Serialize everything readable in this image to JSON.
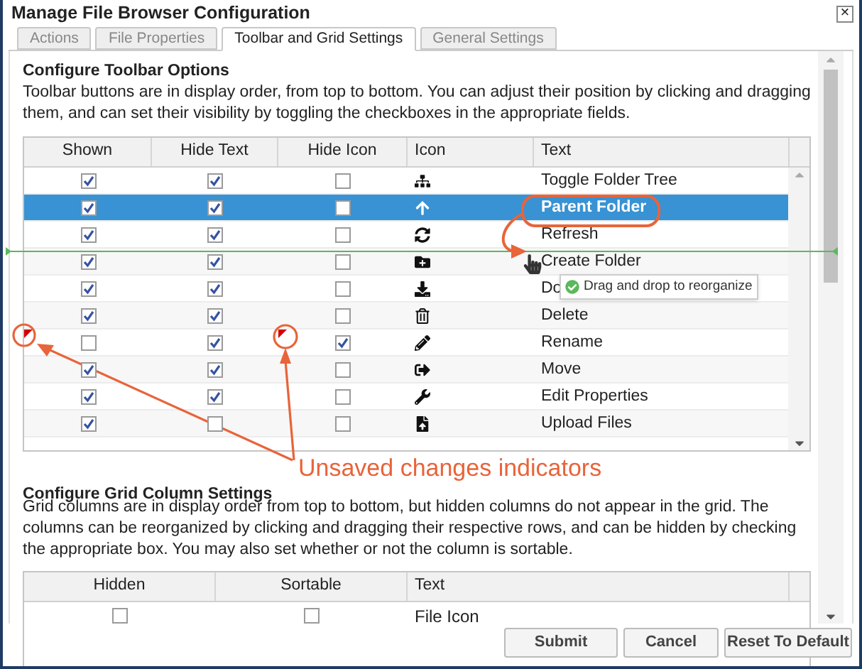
{
  "window": {
    "title": "Manage File Browser Configuration",
    "close": "×"
  },
  "tabs": [
    {
      "label": "Actions",
      "selected": false
    },
    {
      "label": "File Properties",
      "selected": false
    },
    {
      "label": "Toolbar and Grid Settings",
      "selected": true
    },
    {
      "label": "General Settings",
      "selected": false
    }
  ],
  "toolbar_section": {
    "heading": "Configure Toolbar Options",
    "description": "Toolbar buttons are in display order, from top to bottom. You can adjust their position by clicking and dragging them, and can set their visibility by toggling the checkboxes in the appropriate fields.",
    "columns": [
      "Shown",
      "Hide Text",
      "Hide Icon",
      "Icon",
      "Text"
    ],
    "rows": [
      {
        "kind": "tree",
        "text": "Toggle Folder Tree",
        "shown": true,
        "hide_text": true,
        "hide_icon": false,
        "shown_changed": false,
        "hide_icon_changed": false,
        "selected": false
      },
      {
        "kind": "up",
        "text": "Parent Folder",
        "shown": true,
        "hide_text": true,
        "hide_icon": false,
        "shown_changed": false,
        "hide_icon_changed": false,
        "selected": true
      },
      {
        "kind": "refresh",
        "text": "Refresh",
        "shown": true,
        "hide_text": true,
        "hide_icon": false,
        "shown_changed": false,
        "hide_icon_changed": false,
        "selected": false
      },
      {
        "kind": "folder",
        "text": "Create Folder",
        "shown": true,
        "hide_text": true,
        "hide_icon": false,
        "shown_changed": false,
        "hide_icon_changed": false,
        "selected": false
      },
      {
        "kind": "download",
        "text": "Do",
        "shown": true,
        "hide_text": true,
        "hide_icon": false,
        "shown_changed": false,
        "hide_icon_changed": false,
        "selected": false
      },
      {
        "kind": "trash",
        "text": "Delete",
        "shown": true,
        "hide_text": true,
        "hide_icon": false,
        "shown_changed": false,
        "hide_icon_changed": false,
        "selected": false
      },
      {
        "kind": "pencil",
        "text": "Rename",
        "shown": false,
        "hide_text": true,
        "hide_icon": true,
        "shown_changed": true,
        "hide_icon_changed": true,
        "selected": false
      },
      {
        "kind": "move",
        "text": "Move",
        "shown": true,
        "hide_text": true,
        "hide_icon": false,
        "shown_changed": false,
        "hide_icon_changed": false,
        "selected": false
      },
      {
        "kind": "wrench",
        "text": "Edit Properties",
        "shown": true,
        "hide_text": true,
        "hide_icon": false,
        "shown_changed": false,
        "hide_icon_changed": false,
        "selected": false
      },
      {
        "kind": "upload",
        "text": "Upload Files",
        "shown": true,
        "hide_text": false,
        "hide_icon": false,
        "shown_changed": false,
        "hide_icon_changed": false,
        "selected": false
      }
    ],
    "drag_tooltip": "Drag and drop to reorganize"
  },
  "annotation": {
    "label": "Unsaved changes indicators"
  },
  "grid_section": {
    "heading": "Configure Grid Column Settings",
    "description": "Grid columns are in display order from top to bottom, but hidden columns do not appear in the grid. The columns can be reorganized by clicking and dragging their respective rows, and can be hidden by checking the appropriate box. You may also set whether or not the column is sortable.",
    "columns": [
      "Hidden",
      "Sortable",
      "Text"
    ],
    "rows": [
      {
        "text": "File Icon",
        "hidden": false,
        "sortable": false
      }
    ]
  },
  "buttons": [
    "Submit",
    "Cancel",
    "Reset To Default"
  ]
}
